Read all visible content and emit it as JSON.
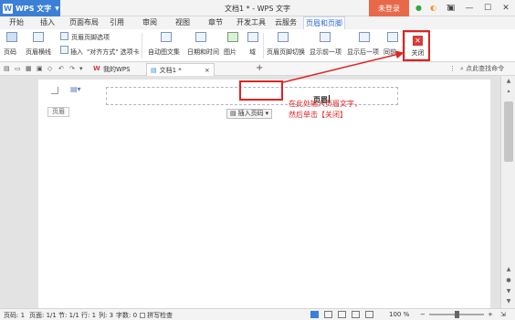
{
  "app": {
    "name": "WPS 文字",
    "logo": "W",
    "window_title": "文档1 * - WPS 文字",
    "login": "未登录"
  },
  "menu": {
    "tabs": [
      "开始",
      "插入",
      "页面布局",
      "引用",
      "审阅",
      "视图",
      "章节",
      "开发工具",
      "云服务",
      "页眉和页脚"
    ],
    "active_index": 9
  },
  "ribbon": {
    "page_number": "页码",
    "header_line": "页眉横线",
    "header_footer_options": "页眉页脚选项",
    "insert": "插入",
    "align_tab": "\"对齐方式\" 选项卡",
    "auto_text": "自动图文集",
    "date_time": "日期和时间",
    "picture": "图片",
    "field": "域",
    "switch_header_footer": "页眉页脚切换",
    "show_previous": "显示前一项",
    "show_next": "显示后一项",
    "same_as_prev": "同前",
    "close": "关闭"
  },
  "tabbar": {
    "my_wps": "我的WPS",
    "doc_tab": "文档1 *",
    "find_command": "点此查找命令"
  },
  "document": {
    "header_label": "页眉",
    "header_text": "页眉",
    "insert_page_number": "插入页码",
    "annotation_line1": "在此处输入页眉文字，",
    "annotation_line2": "然后单击【关闭】"
  },
  "status": {
    "page": "页码: 1",
    "pages": "页面: 1/1",
    "section": "节: 1/1",
    "row": "行: 1",
    "col": "列: 3",
    "words": "字数: 0",
    "spell": "拼写检查",
    "zoom": "100 %"
  },
  "colors": {
    "accent": "#3c7fd6",
    "login": "#e8694a",
    "annotation": "#e02222"
  }
}
